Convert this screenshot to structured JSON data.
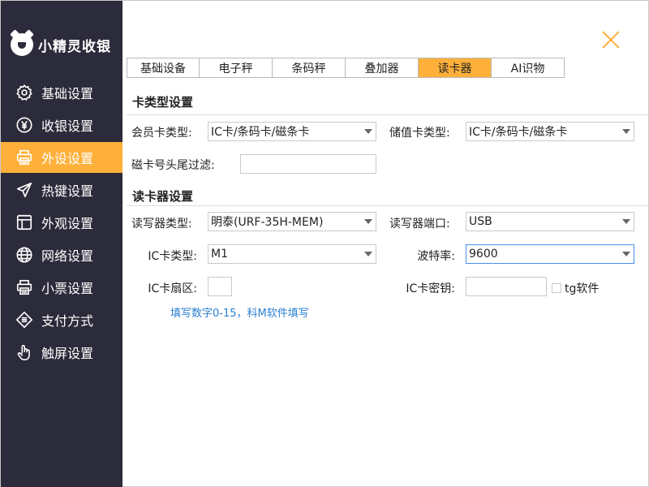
{
  "app": {
    "name": "小精灵收银"
  },
  "sidebar": {
    "items": [
      {
        "label": "基础设置",
        "icon": "gear-icon",
        "active": false
      },
      {
        "label": "收银设置",
        "icon": "yen-icon",
        "active": false
      },
      {
        "label": "外设设置",
        "icon": "printer-icon",
        "active": true
      },
      {
        "label": "热键设置",
        "icon": "send-icon",
        "active": false
      },
      {
        "label": "外观设置",
        "icon": "layout-icon",
        "active": false
      },
      {
        "label": "网络设置",
        "icon": "globe-icon",
        "active": false
      },
      {
        "label": "小票设置",
        "icon": "printer-icon",
        "active": false
      },
      {
        "label": "支付方式",
        "icon": "payment-icon",
        "active": false
      },
      {
        "label": "触屏设置",
        "icon": "touch-icon",
        "active": false
      }
    ]
  },
  "tabs": [
    {
      "label": "基础设备",
      "active": false
    },
    {
      "label": "电子秤",
      "active": false
    },
    {
      "label": "条码秤",
      "active": false
    },
    {
      "label": "叠加器",
      "active": false
    },
    {
      "label": "读卡器",
      "active": true
    },
    {
      "label": "AI识物",
      "active": false
    }
  ],
  "card_type_section": {
    "title": "卡类型设置",
    "member_card_type": {
      "label": "会员卡类型:",
      "value": "IC卡/条码卡/磁条卡"
    },
    "stored_card_type": {
      "label": "储值卡类型:",
      "value": "IC卡/条码卡/磁条卡"
    },
    "mag_filter": {
      "label": "磁卡号头尾过滤:",
      "value": ""
    }
  },
  "reader_section": {
    "title": "读卡器设置",
    "reader_type": {
      "label": "读写器类型:",
      "value": "明泰(URF-35H-MEM)"
    },
    "reader_port": {
      "label": "读写器端口:",
      "value": "USB"
    },
    "ic_card_type": {
      "label": "IC卡类型:",
      "value": "M1"
    },
    "baud_rate": {
      "label": "波特率:",
      "value": "9600"
    },
    "ic_sector": {
      "label": "IC卡扇区:",
      "value": ""
    },
    "ic_key": {
      "label": "IC卡密钥:",
      "value": ""
    },
    "tg_software": {
      "label": "tg软件",
      "checked": false
    },
    "hint": "填写数字0-15，科M软件填写"
  },
  "colors": {
    "sidebar_bg": "#2b2b3b",
    "accent": "#ffb03a",
    "hint": "#2a7fd1"
  }
}
